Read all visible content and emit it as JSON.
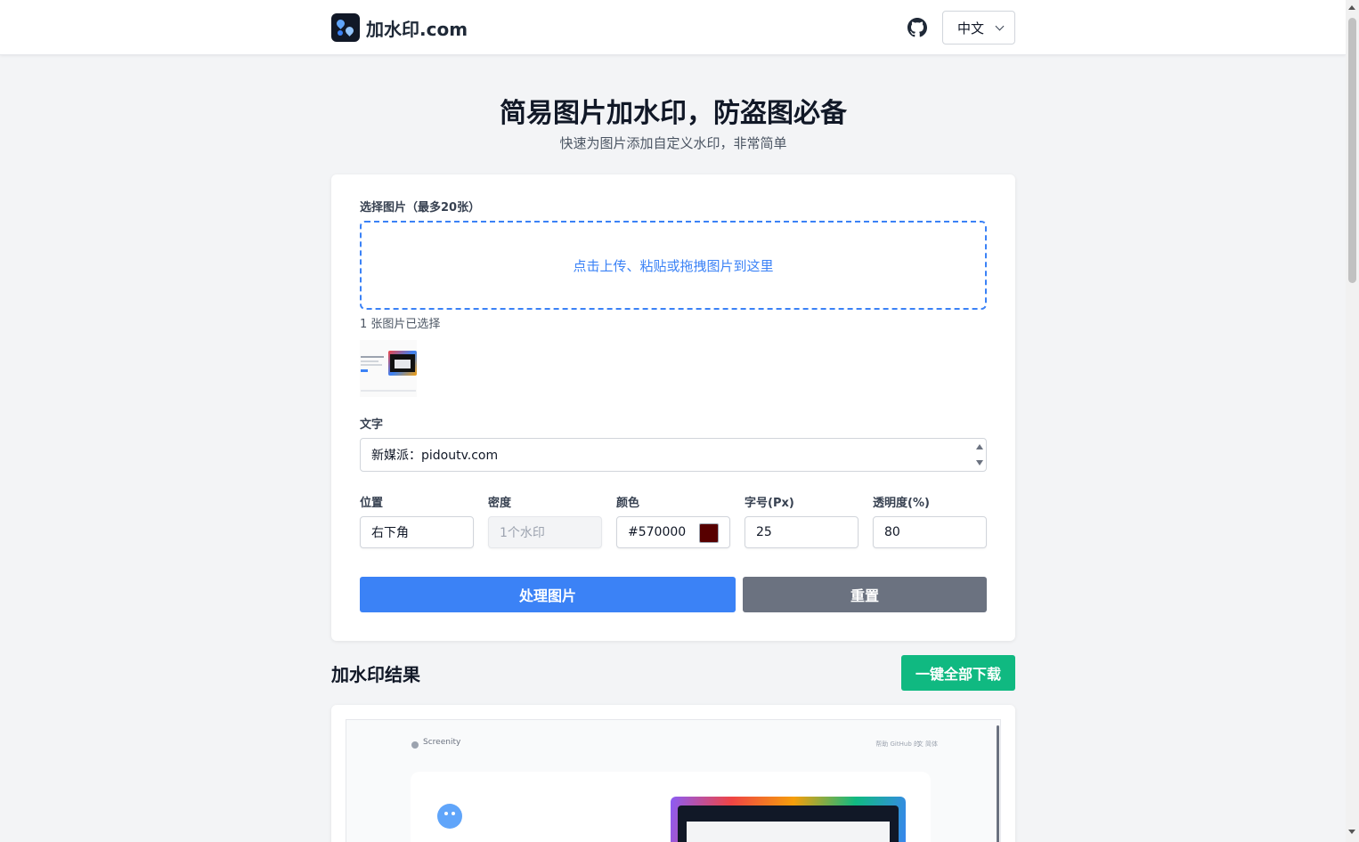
{
  "header": {
    "brand": "加水印.com",
    "language": "中文"
  },
  "hero": {
    "title": "简易图片加水印，防盗图必备",
    "subtitle": "快速为图片添加自定义水印，非常简单"
  },
  "form": {
    "select_label": "选择图片（最多20张）",
    "dropzone_text": "点击上传、粘贴或拖拽图片到这里",
    "selected_count": "1 张图片已选择",
    "text_label": "文字",
    "text_value": "新媒派：pidoutv.com",
    "fields": [
      {
        "label": "位置",
        "value": "右下角",
        "disabled": false
      },
      {
        "label": "密度",
        "value": "1个水印",
        "disabled": true
      },
      {
        "label": "颜色",
        "value": "#570000",
        "swatch": "#570000"
      },
      {
        "label": "字号(Px)",
        "value": "25"
      },
      {
        "label": "透明度(%)",
        "value": "80"
      }
    ],
    "process_button": "处理图片",
    "reset_button": "重置"
  },
  "results": {
    "title": "加水印结果",
    "download_all": "一键全部下载",
    "preview": {
      "brand": "Screenity",
      "nav": "帮助   GitHub 的",
      "lang": "文 简体"
    }
  },
  "colors": {
    "primary": "#3b82f6",
    "reset": "#6b7280",
    "download": "#10b981"
  }
}
